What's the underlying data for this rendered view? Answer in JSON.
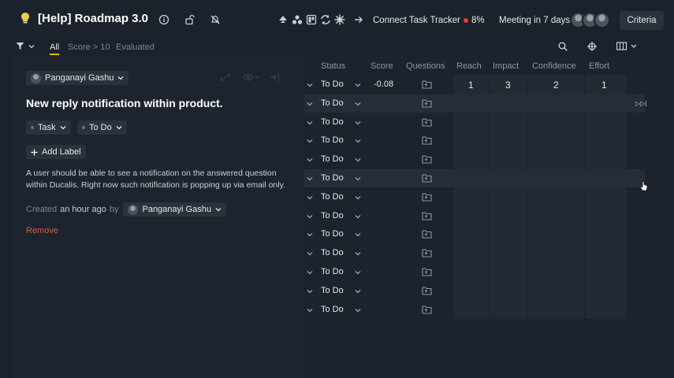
{
  "header": {
    "title": "[Help] Roadmap 3.0",
    "connect_tracker": "Connect Task Tracker",
    "progress_percent": "8%",
    "meeting": "Meeting in 7 days",
    "criteria_button": "Criteria"
  },
  "filters": {
    "tabs": [
      "All",
      "Score > 10",
      "Evaluated"
    ],
    "active_tab": "All"
  },
  "detail": {
    "assignee": "Panganayi Gashu",
    "title": "New reply notification within product.",
    "type": "Task",
    "status": "To Do",
    "add_label": "Add Label",
    "description": "A user should be able to see a notification on the answered question within Ducalis. Right now such notification is popping up via email only.",
    "created_prefix": "Created",
    "created_time": "an hour ago",
    "created_by": "by",
    "creator": "Panganayi Gashu",
    "remove": "Remove"
  },
  "grid": {
    "columns": [
      "Status",
      "Score",
      "Questions",
      "Reach",
      "Impact",
      "Confidence",
      "Effort"
    ],
    "rows": [
      {
        "status": "To Do",
        "score": "-0.08",
        "reach": "1",
        "impact": "3",
        "confidence": "2",
        "effort": "1"
      },
      {
        "status": "To Do",
        "score": "",
        "reach": "",
        "impact": "",
        "confidence": "",
        "effort": ""
      },
      {
        "status": "To Do",
        "score": "",
        "reach": "",
        "impact": "",
        "confidence": "",
        "effort": ""
      },
      {
        "status": "To Do",
        "score": "",
        "reach": "",
        "impact": "",
        "confidence": "",
        "effort": ""
      },
      {
        "status": "To Do",
        "score": "",
        "reach": "",
        "impact": "",
        "confidence": "",
        "effort": ""
      },
      {
        "status": "To Do",
        "score": "",
        "reach": "",
        "impact": "",
        "confidence": "",
        "effort": ""
      },
      {
        "status": "To Do",
        "score": "",
        "reach": "",
        "impact": "",
        "confidence": "",
        "effort": ""
      },
      {
        "status": "To Do",
        "score": "",
        "reach": "",
        "impact": "",
        "confidence": "",
        "effort": ""
      },
      {
        "status": "To Do",
        "score": "",
        "reach": "",
        "impact": "",
        "confidence": "",
        "effort": ""
      },
      {
        "status": "To Do",
        "score": "",
        "reach": "",
        "impact": "",
        "confidence": "",
        "effort": ""
      },
      {
        "status": "To Do",
        "score": "",
        "reach": "",
        "impact": "",
        "confidence": "",
        "effort": ""
      },
      {
        "status": "To Do",
        "score": "",
        "reach": "",
        "impact": "",
        "confidence": "",
        "effort": ""
      },
      {
        "status": "To Do",
        "score": "",
        "reach": "",
        "impact": "",
        "confidence": "",
        "effort": ""
      }
    ],
    "highlighted_rows": [
      1,
      5
    ]
  },
  "icons": {
    "bulb": "lightbulb-icon",
    "info": "info-icon",
    "lock": "unlock-icon",
    "notify": "bell-off-icon",
    "integrations": [
      "jira-icon",
      "asana-icon",
      "trello-icon",
      "sync-icon",
      "settings-icon"
    ],
    "arrow": "arrow-right-icon"
  },
  "colors": {
    "accent": "#f2b600",
    "remove": "#d2603f",
    "progress_dot": "#e0432b",
    "chip_dot": "#3a7bd5"
  }
}
